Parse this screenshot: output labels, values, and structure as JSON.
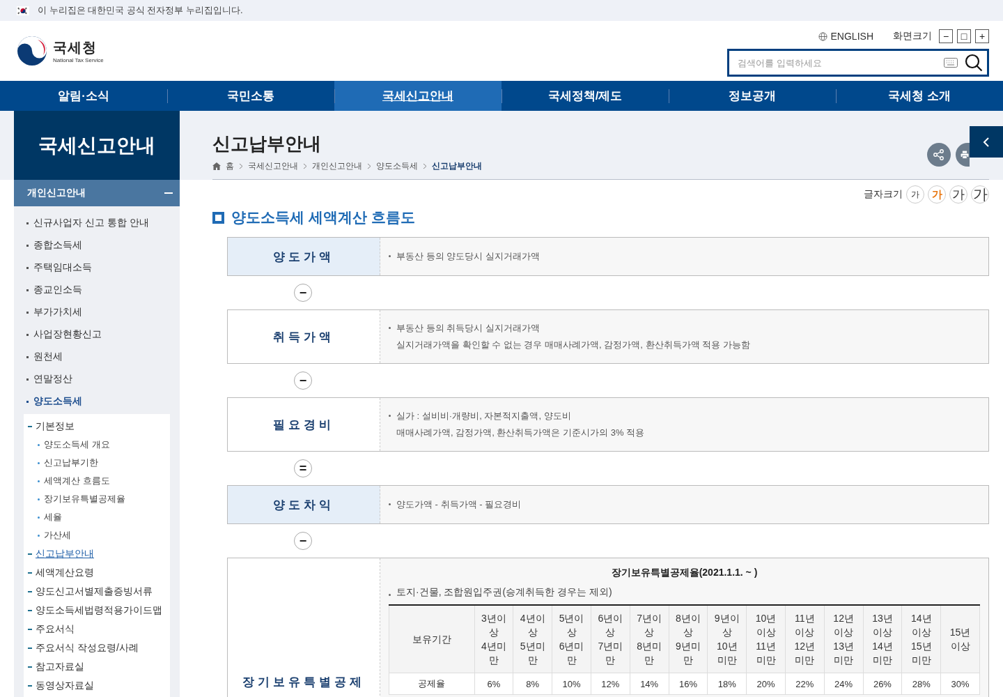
{
  "gov_banner": {
    "text": "이 누리집은 대한민국 공식 전자정부 누리집입니다."
  },
  "header": {
    "logo": {
      "name": "국세청",
      "subtitle": "National Tax Service"
    },
    "language_link": "ENGLISH",
    "zoom": {
      "label": "화면크기",
      "buttons": [
        "−",
        "□",
        "+"
      ]
    },
    "search": {
      "placeholder": "검색어를 입력하세요"
    }
  },
  "nav": [
    {
      "label": "알림·소식",
      "selected": false
    },
    {
      "label": "국민소통",
      "selected": false
    },
    {
      "label": "국세신고안내",
      "selected": true
    },
    {
      "label": "국세정책/제도",
      "selected": false
    },
    {
      "label": "정보공개",
      "selected": false
    },
    {
      "label": "국세청 소개",
      "selected": false
    }
  ],
  "sidebar": {
    "title": "국세신고안내",
    "section": {
      "label": "개인신고안내",
      "expanded": true
    },
    "items": [
      {
        "label": "신규사업자 신고 통합 안내",
        "selected": false
      },
      {
        "label": "종합소득세",
        "selected": false
      },
      {
        "label": "주택임대소득",
        "selected": false
      },
      {
        "label": "종교인소득",
        "selected": false
      },
      {
        "label": "부가가치세",
        "selected": false
      },
      {
        "label": "사업장현황신고",
        "selected": false
      },
      {
        "label": "원천세",
        "selected": false
      },
      {
        "label": "연말정산",
        "selected": false
      },
      {
        "label": "양도소득세",
        "selected": true,
        "children": [
          {
            "label": "기본정보",
            "selected": false,
            "children": [
              {
                "label": "양도소득세 개요",
                "selected": false
              },
              {
                "label": "신고납부기한",
                "selected": false
              },
              {
                "label": "세액계산 흐름도",
                "selected": false
              },
              {
                "label": "장기보유특별공제율",
                "selected": false
              },
              {
                "label": "세율",
                "selected": false
              },
              {
                "label": "가산세",
                "selected": false
              }
            ]
          },
          {
            "label": "신고납부안내",
            "selected": true
          },
          {
            "label": "세액계산요령",
            "selected": false
          },
          {
            "label": "양도신고서별제출증빙서류",
            "selected": false
          },
          {
            "label": "양도소득세법령적용가이드맵",
            "selected": false
          },
          {
            "label": "주요서식",
            "selected": false
          },
          {
            "label": "주요서식 작성요령/사례",
            "selected": false
          },
          {
            "label": "참고자료실",
            "selected": false
          },
          {
            "label": "동영상자료실",
            "selected": false
          }
        ]
      }
    ]
  },
  "page": {
    "title": "신고납부안내",
    "breadcrumb": [
      {
        "label": "홈",
        "selected": false
      },
      {
        "label": "국세신고안내",
        "selected": false
      },
      {
        "label": "개인신고안내",
        "selected": false
      },
      {
        "label": "양도소득세",
        "selected": false
      },
      {
        "label": "신고납부안내",
        "selected": true
      }
    ],
    "font_size": {
      "label": "글자크기",
      "options": [
        {
          "label": "가",
          "selected": false
        },
        {
          "label": "가",
          "selected": true
        },
        {
          "label": "가",
          "selected": false
        },
        {
          "label": "가",
          "selected": false
        }
      ]
    }
  },
  "section_title": "양도소득세 세액계산 흐름도",
  "flow": [
    {
      "kind": "step",
      "label": "양도가액",
      "highlighted": true,
      "lines": [
        "부동산 등의 양도당시 실지거래가액"
      ]
    },
    {
      "kind": "operator",
      "symbol": "−"
    },
    {
      "kind": "step",
      "label": "취득가액",
      "highlighted": false,
      "lines": [
        "부동산 등의 취득당시 실지거래가액",
        "실지거래가액을 확인할 수 없는 경우 매매사례가액, 감정가액, 환산취득가액 적용 가능함"
      ]
    },
    {
      "kind": "operator",
      "symbol": "−"
    },
    {
      "kind": "step",
      "label": "필요경비",
      "highlighted": false,
      "lines": [
        "실가 : 설비비·개량비, 자본적지출액, 양도비",
        "매매사례가액, 감정가액, 환산취득가액은 기준시가의 3% 적용"
      ]
    },
    {
      "kind": "operator",
      "symbol": "="
    },
    {
      "kind": "step",
      "label": "양도차익",
      "highlighted": true,
      "lines": [
        "양도가액 - 취득가액 - 필요경비"
      ]
    },
    {
      "kind": "operator",
      "symbol": "−"
    },
    {
      "kind": "table_step",
      "label": "장기보유특별공제",
      "highlighted": false,
      "table_title": "장기보유특별공제율(2021.1.1. ~ )",
      "note": "토지·건물, 조합원입주권(승계취득한 경우는 제외)",
      "table": {
        "columns": [
          "보유기간",
          "3년이상 4년미만",
          "4년이상 5년미만",
          "5년이상 6년미만",
          "6년이상 7년미만",
          "7년이상 8년미만",
          "8년이상 9년미만",
          "9년이상 10년미만",
          "10년 이상 11년 미만",
          "11년 이상 12년 미만",
          "12년 이상 13년 미만",
          "13년 이상 14년 미만",
          "14년 이상 15년 미만",
          "15년 이상"
        ],
        "rows": [
          [
            "공제율",
            "6%",
            "8%",
            "10%",
            "12%",
            "14%",
            "16%",
            "18%",
            "20%",
            "22%",
            "24%",
            "26%",
            "28%",
            "30%"
          ]
        ]
      }
    }
  ]
}
